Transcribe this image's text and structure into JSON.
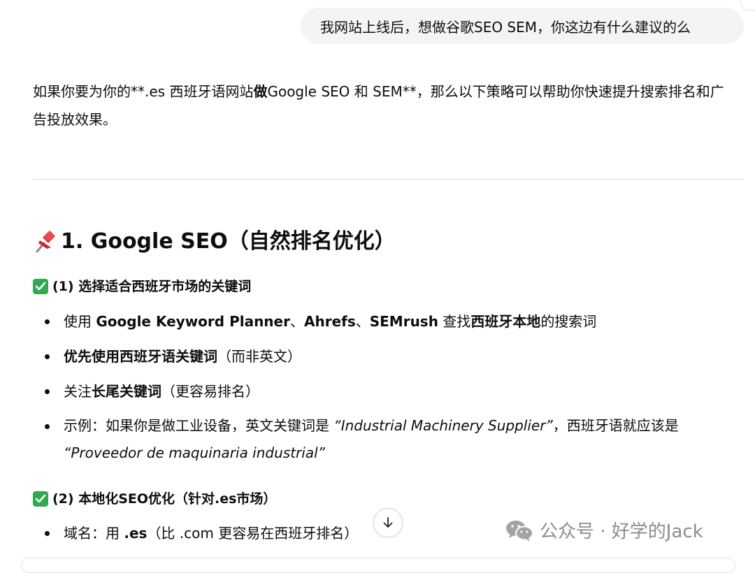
{
  "user_message": "我网站上线后，想做谷歌SEO SEM，你这边有什么建议的么",
  "intro": {
    "p1": "如果你要为你的**.es 西班牙语网站",
    "p1_bold": "做",
    "p2": "Google SEO 和 SEM**，那么以下策略可以帮助你快速提升搜索排名和广告投放效果。"
  },
  "section1": {
    "title": "1. Google SEO（自然排名优化）",
    "icon": "pushpin-icon"
  },
  "sub1": {
    "title": "(1) 选择适合西班牙市场的关键词",
    "icon": "check-mark-button-icon",
    "items": [
      {
        "a": "使用 ",
        "b": "Google Keyword Planner",
        "c": "、",
        "d": "Ahrefs",
        "e": "、",
        "f": "SEMrush",
        "g": " 查找",
        "h": "西班牙本地",
        "i": "的搜索词"
      },
      {
        "bold": "优先使用西班牙语关键词",
        "rest": "（而非英文）"
      },
      {
        "pre": "关注",
        "bold": "长尾关键词",
        "rest": "（更容易排名）"
      },
      {
        "pre": "示例：如果你是做工业设备，英文关键词是 ",
        "it1": "“Industrial Machinery Supplier”",
        "mid": "，西班牙语就应该是 ",
        "it2": "“Proveedor de maquinaria industrial”"
      }
    ]
  },
  "sub2": {
    "title": "(2) 本地化SEO优化（针对.es市场）",
    "icon": "check-mark-button-icon",
    "items": [
      {
        "pre": "域名：用 ",
        "bold": ".es",
        "rest": "（比 .com 更容易在西班牙排名）"
      }
    ]
  },
  "watermark": "公众号 · 好学的Jack",
  "colors": {
    "bubble_bg": "#f4f4f4",
    "check_green": "#32a852",
    "text": "#0d0d0d",
    "watermark": "#8d8d8d"
  }
}
